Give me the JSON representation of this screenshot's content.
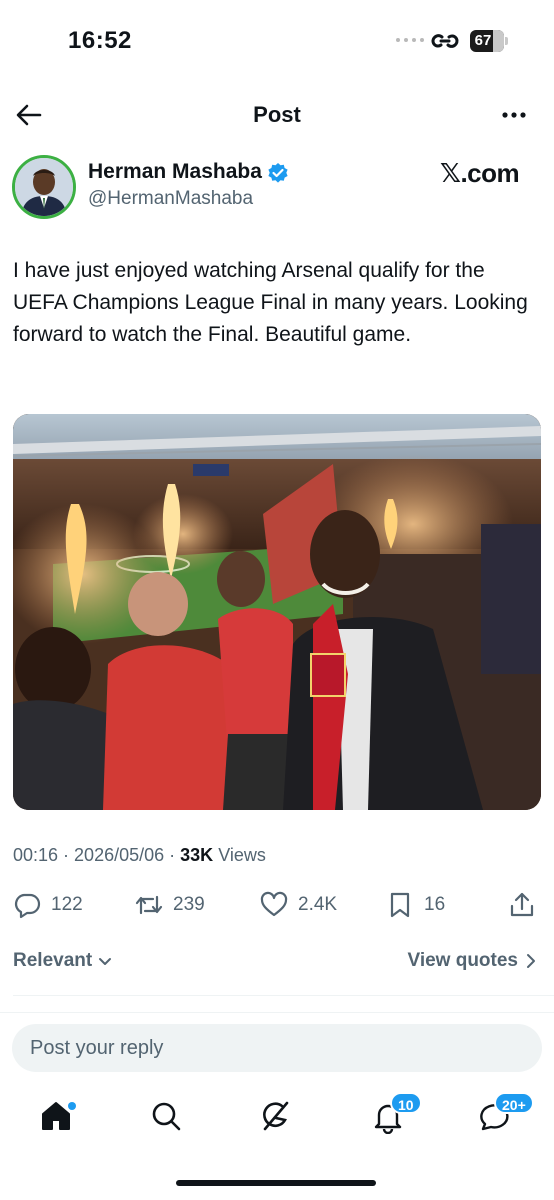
{
  "status_bar": {
    "time": "16:52",
    "battery": "67"
  },
  "header": {
    "title": "Post"
  },
  "author": {
    "name": "Herman Mashaba",
    "handle": "@HermanMashaba",
    "verified": true,
    "source_label": "𝕏.com"
  },
  "tweet": {
    "text": "I have just enjoyed watching Arsenal qualify for the UEFA Champions League Final in many years. Looking forward to watch the Final. Beautiful game."
  },
  "meta": {
    "time": "00:16",
    "date": "2026/05/06",
    "views_count": "33K",
    "views_label": "Views"
  },
  "actions": {
    "replies": "122",
    "reposts": "239",
    "likes": "2.4K",
    "bookmarks": "16"
  },
  "replies_section": {
    "sort_label": "Relevant",
    "view_quotes_label": "View quotes"
  },
  "reply_box": {
    "placeholder": "Post your reply"
  },
  "bottom_nav": {
    "notifications_badge": "10",
    "messages_badge": "20+"
  },
  "colors": {
    "accent": "#1d9bf0",
    "secondary_text": "#536471",
    "avatar_ring": "#3cb043"
  }
}
